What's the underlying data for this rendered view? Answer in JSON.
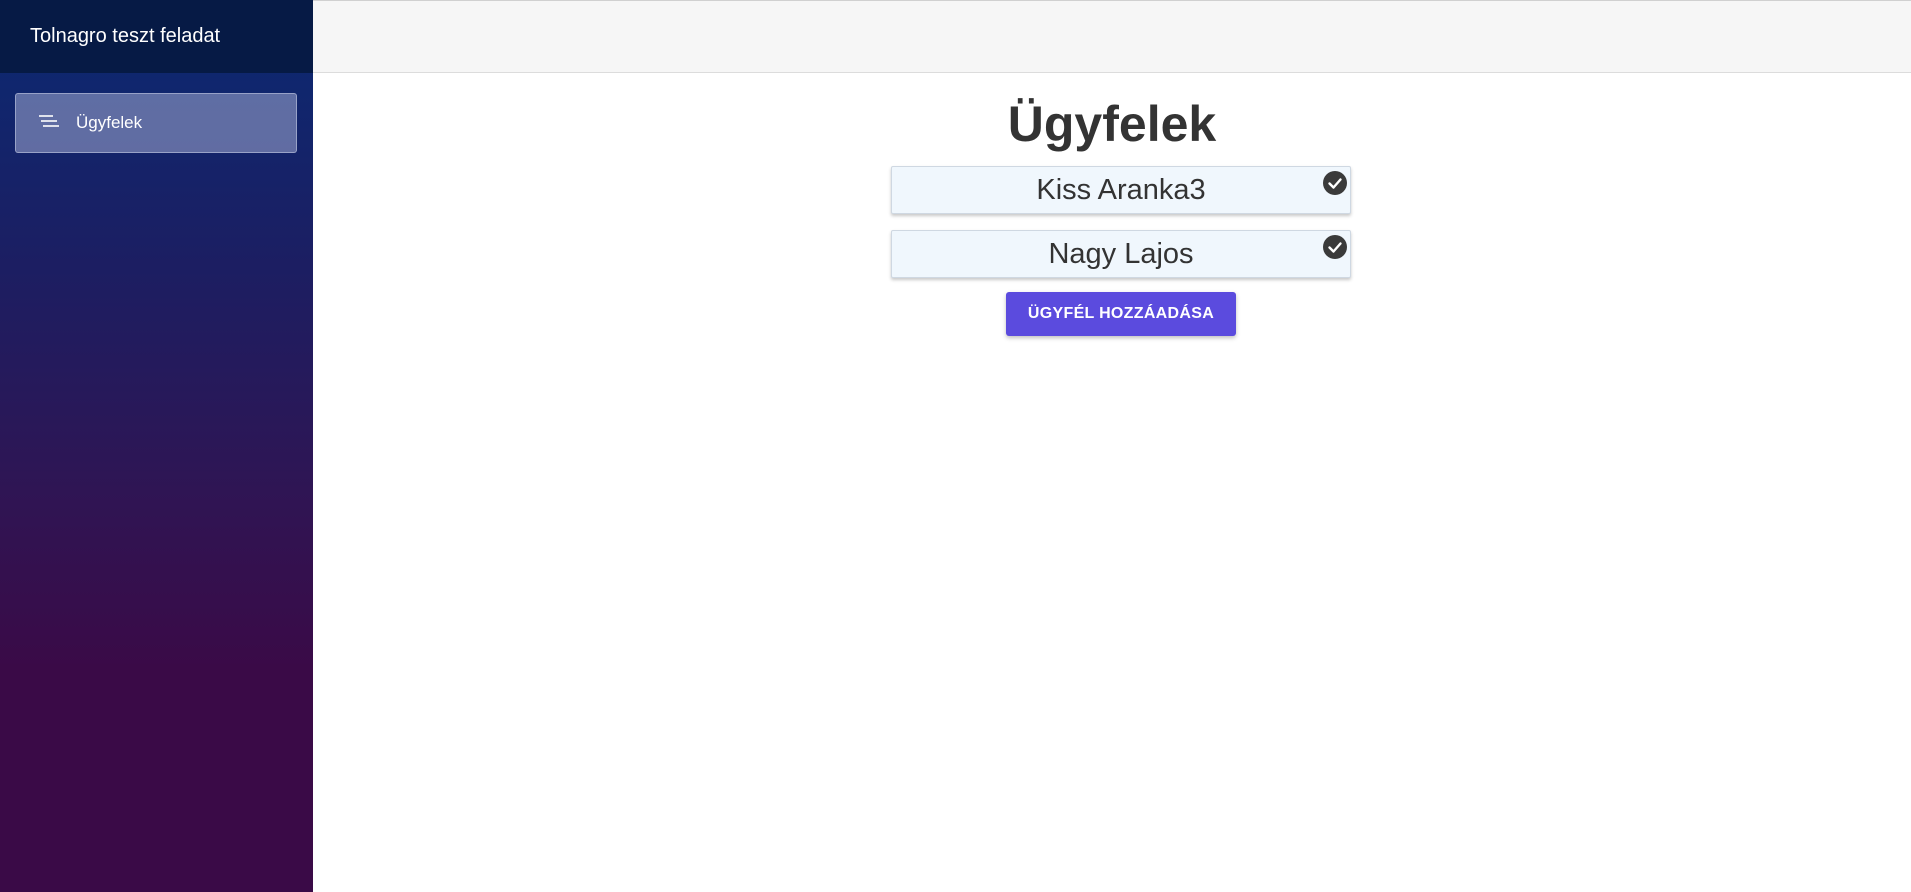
{
  "sidebar": {
    "app_title": "Tolnagro teszt feladat",
    "items": [
      {
        "label": "Ügyfelek",
        "icon": "menu-lines-icon",
        "active": true
      }
    ]
  },
  "main": {
    "title": "Ügyfelek",
    "clients": [
      {
        "name": "Kiss Aranka3",
        "status_icon": "check-circle-icon"
      },
      {
        "name": "Nagy Lajos",
        "status_icon": "check-circle-icon"
      }
    ],
    "add_button_label": "ÜGYFÉL HOZZÁADÁSA"
  },
  "colors": {
    "sidebar_header": "#061a45",
    "sidebar_gradient_top": "#0a2a73",
    "sidebar_gradient_bottom": "#3a0a47",
    "accent_button": "#5b4bde",
    "card_background": "#f0f7fd"
  }
}
